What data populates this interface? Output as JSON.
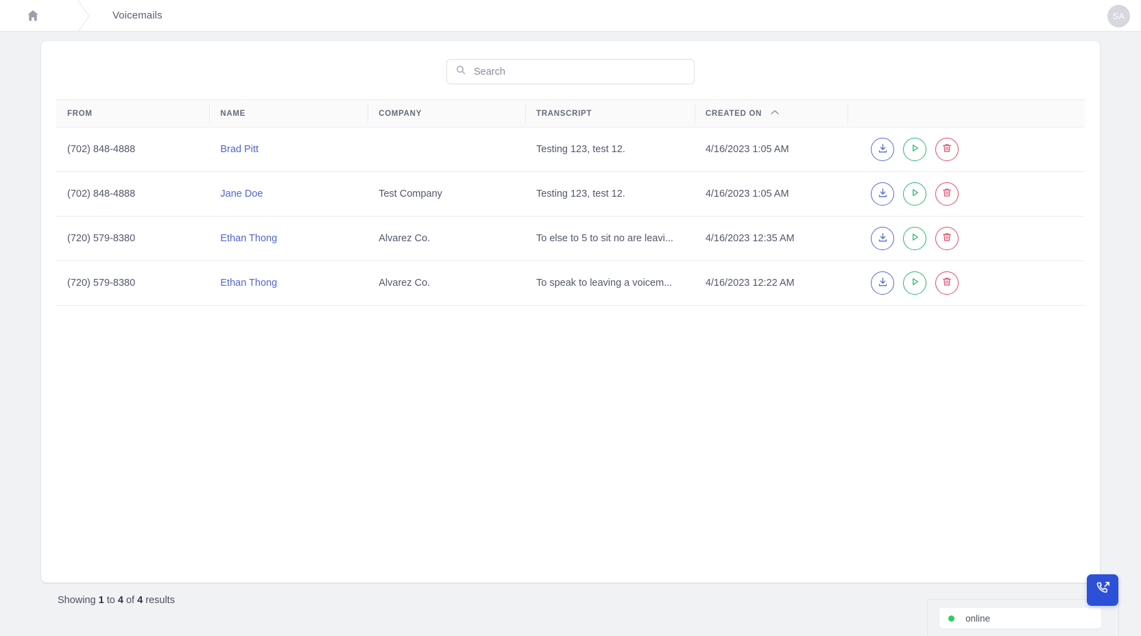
{
  "topbar": {
    "home_icon": "home-icon",
    "breadcrumb_label": "Voicemails",
    "avatar_initials": "SA"
  },
  "search": {
    "placeholder": "Search",
    "value": "",
    "icon": "search-icon"
  },
  "table": {
    "columns": [
      {
        "key": "from",
        "label": "FROM",
        "sortable": false
      },
      {
        "key": "name",
        "label": "NAME",
        "sortable": false
      },
      {
        "key": "company",
        "label": "COMPANY",
        "sortable": false
      },
      {
        "key": "transcript",
        "label": "TRANSCRIPT",
        "sortable": false
      },
      {
        "key": "created_on",
        "label": "CREATED ON",
        "sortable": true,
        "sort_direction": "asc"
      },
      {
        "key": "actions",
        "label": "",
        "sortable": false
      }
    ],
    "rows": [
      {
        "from": "(702) 848-4888",
        "name": "Brad Pitt",
        "company": "",
        "transcript": "Testing 123, test 12.",
        "created_on": "4/16/2023 1:05 AM"
      },
      {
        "from": "(702) 848-4888",
        "name": "Jane Doe",
        "company": "Test Company",
        "transcript": "Testing 123, test 12.",
        "created_on": "4/16/2023 1:05 AM"
      },
      {
        "from": "(720) 579-8380",
        "name": "Ethan Thong",
        "company": "Alvarez Co.",
        "transcript": "To else to 5 to sit no are leavi...",
        "created_on": "4/16/2023 12:35 AM"
      },
      {
        "from": "(720) 579-8380",
        "name": "Ethan Thong",
        "company": "Alvarez Co.",
        "transcript": "To speak to leaving a voicem...",
        "created_on": "4/16/2023 12:22 AM"
      }
    ],
    "row_actions": [
      {
        "name": "download-voicemail-button",
        "icon": "download-icon",
        "color": "#5568d8"
      },
      {
        "name": "play-voicemail-button",
        "icon": "play-icon",
        "color": "#2bb673"
      },
      {
        "name": "delete-voicemail-button",
        "icon": "trash-icon",
        "color": "#de4a6b"
      }
    ]
  },
  "footer": {
    "showing_prefix": "Showing ",
    "range_start": "1",
    "to_text": " to ",
    "range_end": "4",
    "of_text": " of ",
    "total": "4",
    "results_text": " results"
  },
  "chat_widget": {
    "status_text": "online",
    "status_color": "#2ecc5e",
    "call_button_icon": "phone-outbound-icon",
    "call_button_color": "#2c50d8"
  }
}
